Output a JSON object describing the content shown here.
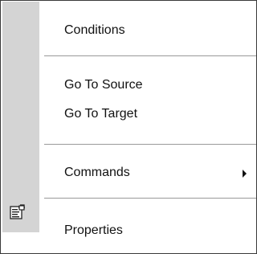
{
  "menu": {
    "items": [
      {
        "label": "Conditions"
      },
      {
        "label": "Go To Source"
      },
      {
        "label": "Go To Target"
      },
      {
        "label": "Commands",
        "has_submenu": true
      },
      {
        "label": "Properties",
        "icon": "properties-icon"
      }
    ]
  },
  "colors": {
    "gutter": "#d4d4d4",
    "border": "#3a3a3a",
    "separator": "#9a9a9a",
    "text": "#111111"
  }
}
